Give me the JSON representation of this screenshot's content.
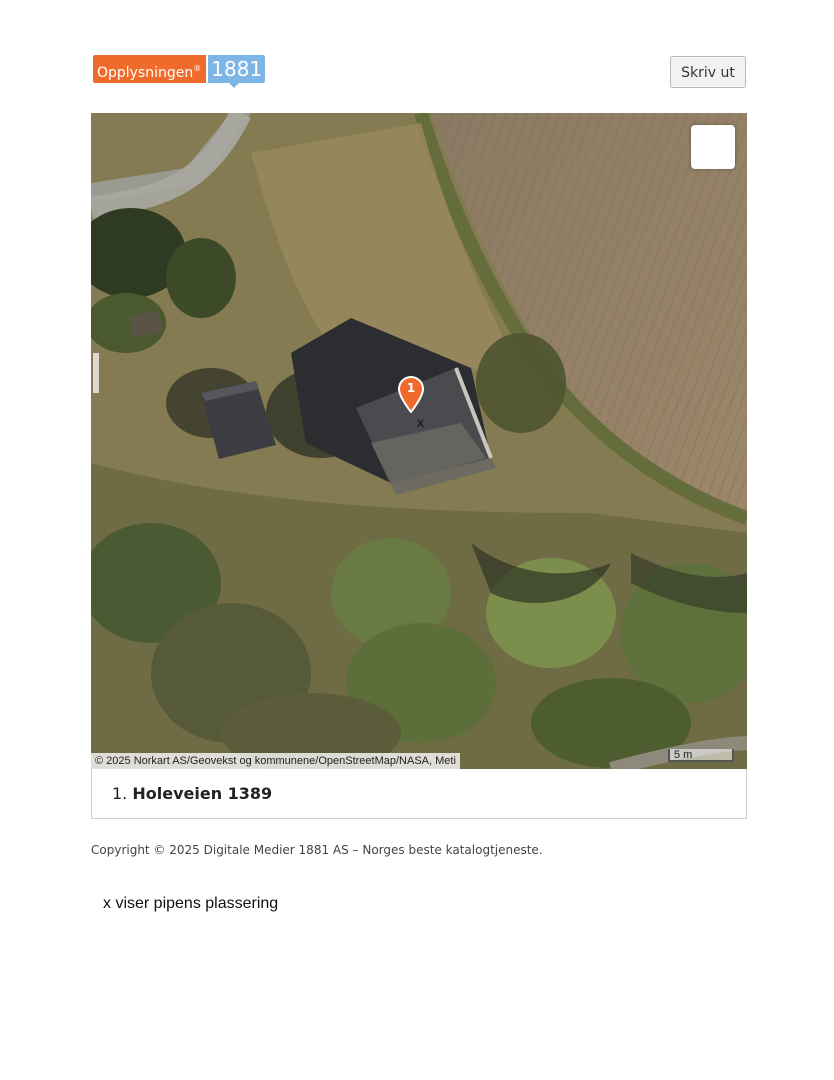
{
  "header": {
    "logo_text": "Opplysningen",
    "logo_registered": "®",
    "logo_number": "1881",
    "print_label": "Skriv ut"
  },
  "map": {
    "marker_number": "1",
    "chimney_marker": "x",
    "attribution": "© 2025 Norkart AS/Geovekst og kommunene/OpenStreetMap/NASA, Meti",
    "scale_label": "5 m",
    "layer": "aerial imagery",
    "colors": {
      "marker": "#ef6a2b",
      "vegetation": "#5f6f3a",
      "field": "#a08a6a",
      "roof": "#3a3c40"
    }
  },
  "results": [
    {
      "index": "1.",
      "address": "Holeveien 1389"
    }
  ],
  "footer": {
    "copyright": "Copyright © 2025 Digitale Medier 1881 AS – Norges beste katalogtjeneste."
  },
  "note": "x viser pipens plassering"
}
